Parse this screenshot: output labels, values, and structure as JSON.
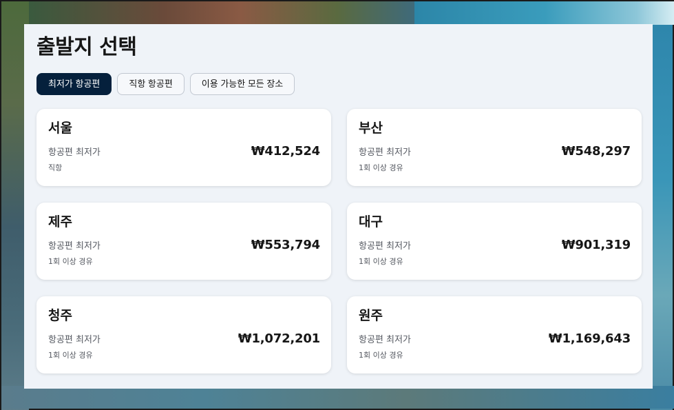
{
  "page": {
    "title": "출발지 선택"
  },
  "tabs": [
    {
      "label": "최저가 항공편",
      "active": true
    },
    {
      "label": "직항 항공편",
      "active": false
    },
    {
      "label": "이용 가능한 모든 장소",
      "active": false
    }
  ],
  "destinations": [
    {
      "city": "서울",
      "label": "항공편 최저가",
      "price": "₩412,524",
      "stops": "직항"
    },
    {
      "city": "부산",
      "label": "항공편 최저가",
      "price": "₩548,297",
      "stops": "1회 이상 경유"
    },
    {
      "city": "제주",
      "label": "항공편 최저가",
      "price": "₩553,794",
      "stops": "1회 이상 경유"
    },
    {
      "city": "대구",
      "label": "항공편 최저가",
      "price": "₩901,319",
      "stops": "1회 이상 경유"
    },
    {
      "city": "청주",
      "label": "항공편 최저가",
      "price": "₩1,072,201",
      "stops": "1회 이상 경유"
    },
    {
      "city": "원주",
      "label": "항공편 최저가",
      "price": "₩1,169,643",
      "stops": "1회 이상 경유"
    }
  ],
  "colors": {
    "active_tab": "#05203c",
    "panel_bg": "#eff3f8",
    "card_bg": "#ffffff"
  }
}
